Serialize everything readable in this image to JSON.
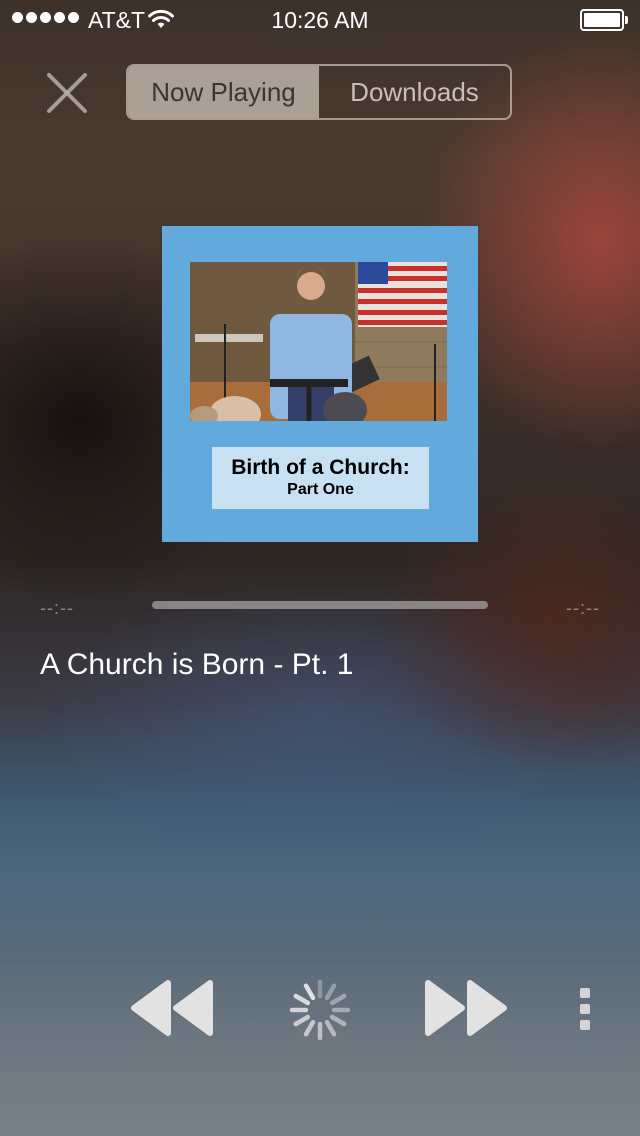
{
  "status_bar": {
    "carrier": "AT&T",
    "time": "10:26 AM",
    "signal_bars": 5,
    "battery_level": 1.0
  },
  "header": {
    "close_icon": "close-icon",
    "tabs": [
      {
        "label": "Now Playing",
        "selected": true
      },
      {
        "label": "Downloads",
        "selected": false
      }
    ]
  },
  "artwork": {
    "title": "Birth of a Church:",
    "subtitle": "Part One",
    "background_color": "#62a9dc"
  },
  "player": {
    "elapsed": "--:--",
    "remaining": "--:--",
    "track_title": "A Church is Born - Pt. 1",
    "progress": 0
  },
  "controls": {
    "rewind_icon": "rewind-icon",
    "loading_icon": "loading-spinner-icon",
    "forward_icon": "fast-forward-icon",
    "more_icon": "more-vertical-icon"
  }
}
